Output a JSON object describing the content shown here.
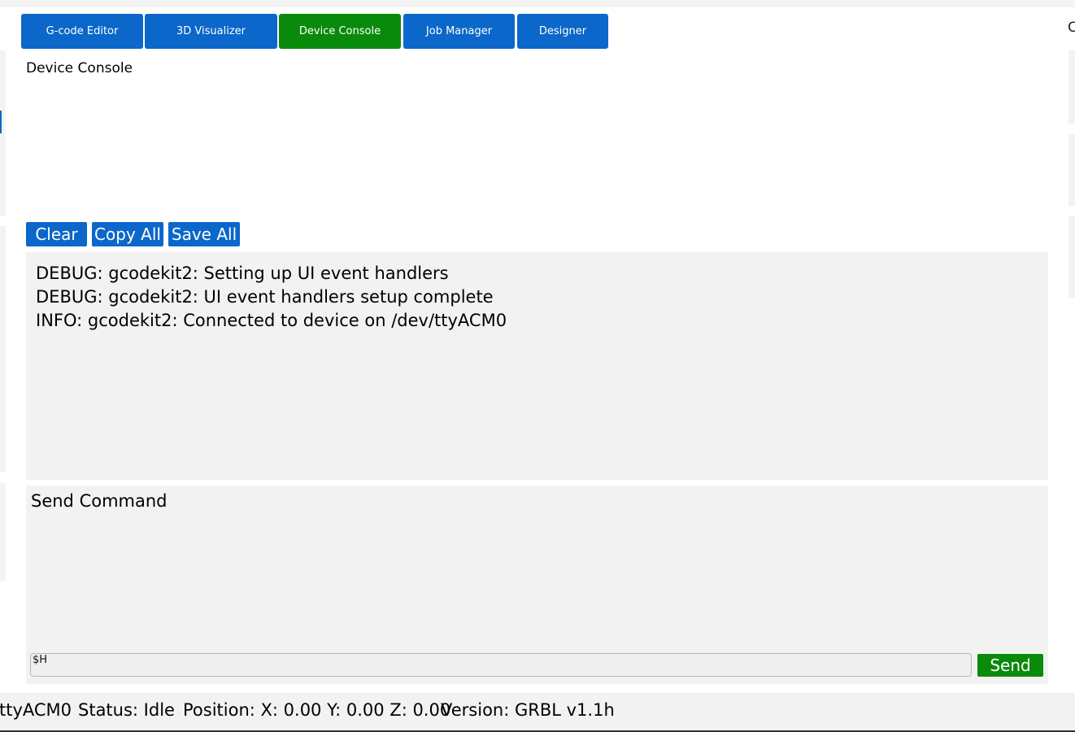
{
  "tabs": [
    {
      "label": "G-code Editor",
      "active": false
    },
    {
      "label": "3D Visualizer",
      "active": false
    },
    {
      "label": "Device Console",
      "active": true
    },
    {
      "label": "Job Manager",
      "active": false
    },
    {
      "label": "Designer",
      "active": false
    }
  ],
  "edge_glyph": "C",
  "console": {
    "title": "Device Console",
    "buttons": {
      "clear": "Clear",
      "copy_all": "Copy All",
      "save_all": "Save All"
    },
    "log_lines": [
      "DEBUG: gcodekit2: Setting up UI event handlers",
      "DEBUG: gcodekit2: UI event handlers setup complete",
      "INFO: gcodekit2: Connected to device on /dev/ttyACM0"
    ]
  },
  "send": {
    "title": "Send Command",
    "input_value": "$H",
    "button_label": "Send"
  },
  "status_bar": {
    "port": "ttyACM0",
    "status": "Status: Idle",
    "position": "Position: X: 0.00 Y: 0.00 Z: 0.00",
    "version": "Version: GRBL v1.1h"
  },
  "colors": {
    "tab_blue": "#0b67c9",
    "active_green": "#0a8a0a",
    "panel_gray": "#f2f2f2"
  }
}
